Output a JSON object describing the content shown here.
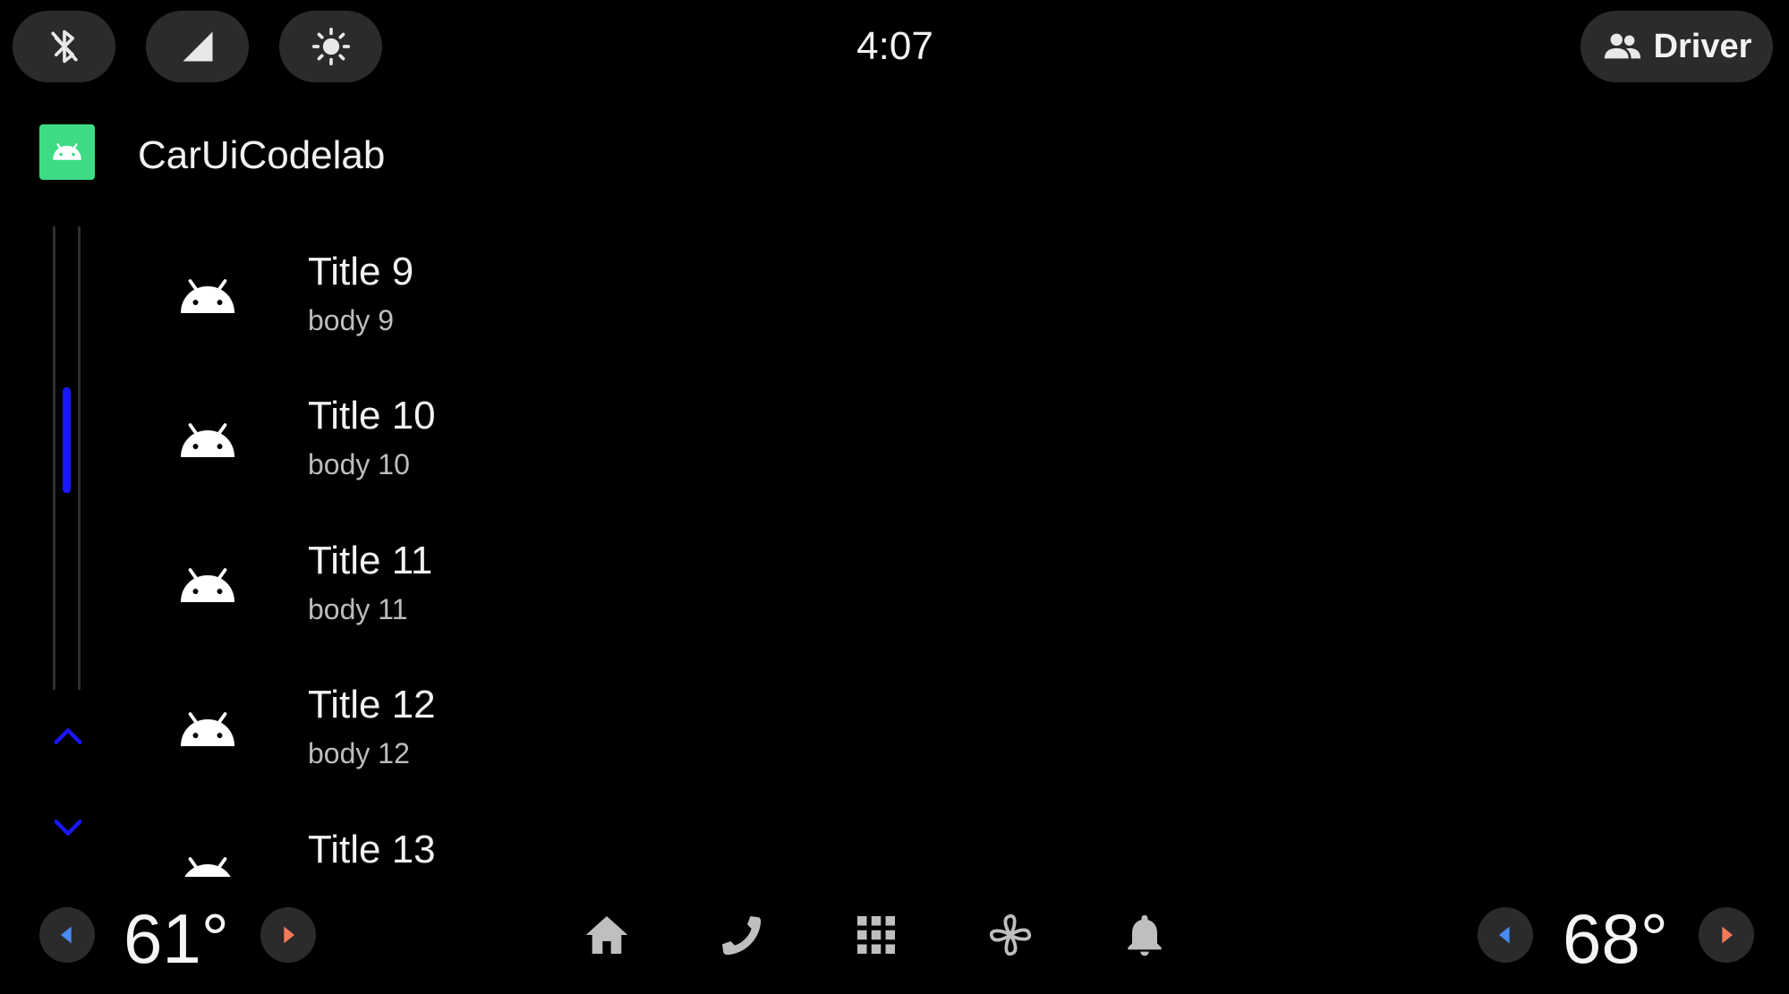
{
  "status_bar": {
    "clock": "4:07",
    "profile_label": "Driver",
    "icons": [
      "bluetooth-off-icon",
      "signal-icon",
      "brightness-icon",
      "people-icon"
    ]
  },
  "app": {
    "title": "CarUiCodelab",
    "icon": "android-icon",
    "icon_color": "#3ddc84"
  },
  "list": {
    "items": [
      {
        "title": "Title 9",
        "body": "body 9"
      },
      {
        "title": "Title 10",
        "body": "body 10"
      },
      {
        "title": "Title 11",
        "body": "body 11"
      },
      {
        "title": "Title 12",
        "body": "body 12"
      },
      {
        "title": "Title 13",
        "body": ""
      }
    ]
  },
  "scrollbar": {
    "accent_color": "#1a17ff",
    "icons": [
      "chevron-up-icon",
      "chevron-down-icon"
    ]
  },
  "bottom_bar": {
    "temp_left": "61°",
    "temp_right": "68°",
    "arrow_left_color": "#4a8bf5",
    "arrow_right_color": "#f47b5a",
    "nav_icons": [
      "home-icon",
      "phone-icon",
      "apps-grid-icon",
      "fan-icon",
      "bell-icon"
    ]
  }
}
